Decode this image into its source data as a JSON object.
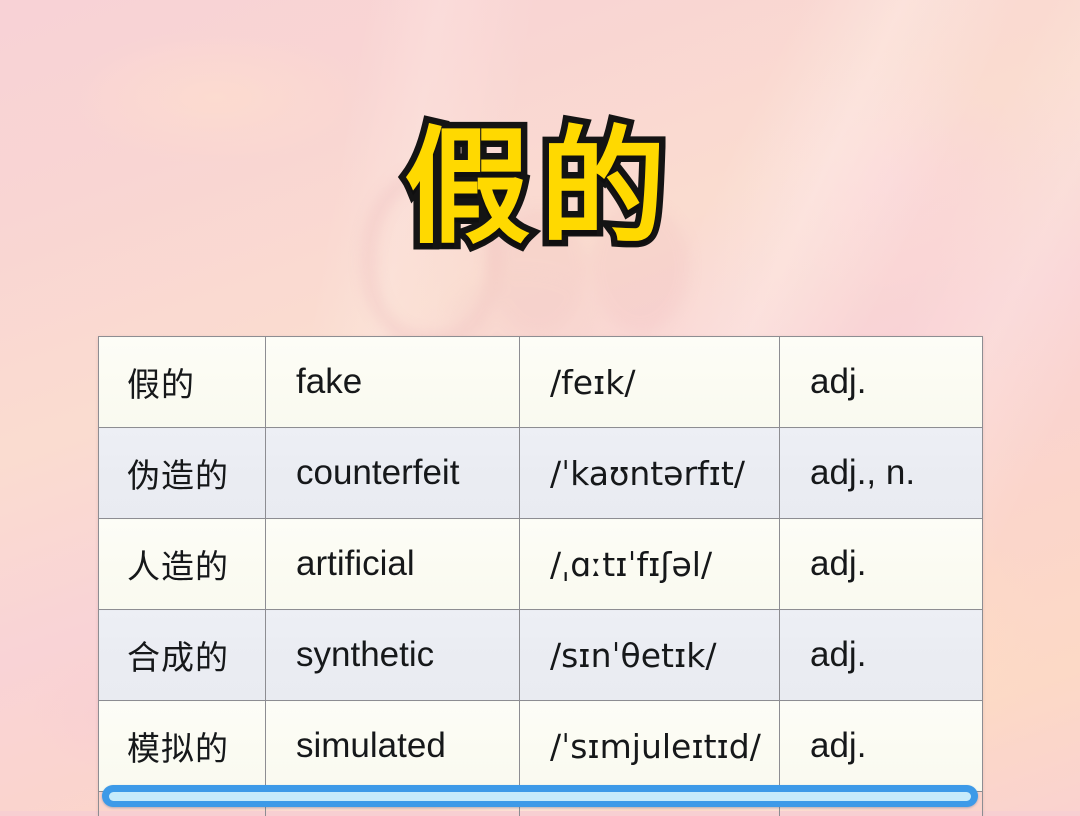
{
  "title": {
    "text": "假的"
  },
  "colors": {
    "title_fill": "#ffd900",
    "title_stroke": "#141414",
    "background_pink": "#f8d2d6",
    "background_peach": "#fcd9c6",
    "row_odd_bg": "#fdfdf7",
    "row_even_bg": "#edeff5",
    "table_border": "#8d8d92",
    "progress_bar": "#3d9ae8",
    "progress_bar_fill": "#c6ebfb"
  },
  "table": {
    "columns": [
      "chinese",
      "english",
      "ipa",
      "part_of_speech"
    ],
    "rows": [
      {
        "chinese": "假的",
        "english": "fake",
        "ipa": "/feɪk/",
        "part_of_speech": "adj."
      },
      {
        "chinese": "伪造的",
        "english": "counterfeit",
        "ipa": "/ˈkaʊntərfɪt/",
        "part_of_speech": "adj., n."
      },
      {
        "chinese": "人造的",
        "english": "artificial",
        "ipa": "/ˌɑːtɪˈfɪʃəl/",
        "part_of_speech": "adj."
      },
      {
        "chinese": "合成的",
        "english": "synthetic",
        "ipa": "/sɪnˈθetɪk/",
        "part_of_speech": "adj."
      },
      {
        "chinese": "模拟的",
        "english": "simulated",
        "ipa": "/ˈsɪmjuleɪtɪd/",
        "part_of_speech": "adj."
      }
    ]
  },
  "progress": {
    "label": ""
  }
}
